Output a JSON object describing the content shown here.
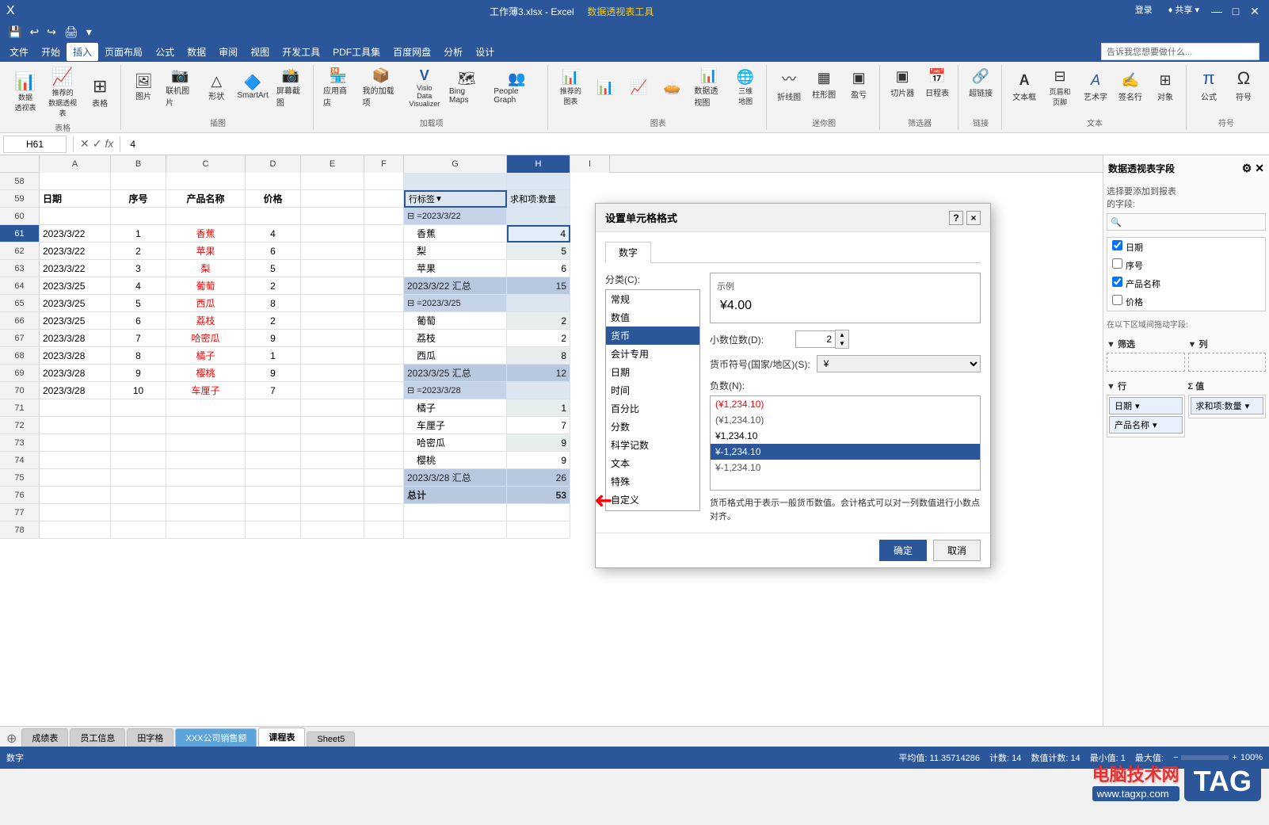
{
  "titleBar": {
    "filename": "工作薄3.xlsx - Excel",
    "toolsTitle": "数据透视表工具",
    "minimizeBtn": "—",
    "maximizeBtn": "□",
    "closeBtn": "✕"
  },
  "menuBar": {
    "items": [
      "文件",
      "开始",
      "插入",
      "页面布局",
      "公式",
      "数据",
      "审阅",
      "视图",
      "开发工具",
      "PDF工具集",
      "百度网盘",
      "分析",
      "设计"
    ]
  },
  "ribbon": {
    "activeTab": "插入",
    "groups": [
      {
        "label": "表格",
        "items": [
          {
            "id": "pivot-data",
            "icon": "📊",
            "label": "数据\n透视表"
          },
          {
            "id": "recommend",
            "icon": "📈",
            "label": "推荐的\n数据透视表"
          },
          {
            "id": "table",
            "icon": "⊞",
            "label": "表格"
          }
        ]
      },
      {
        "label": "插图",
        "items": [
          {
            "id": "image",
            "icon": "🖼",
            "label": "图片"
          },
          {
            "id": "phone-image",
            "icon": "📷",
            "label": "联机图片"
          },
          {
            "id": "shape",
            "icon": "△",
            "label": "形状"
          },
          {
            "id": "smartart",
            "icon": "🔷",
            "label": "SmartArt"
          },
          {
            "id": "screenshot",
            "icon": "📸",
            "label": "屏幕截图"
          }
        ]
      },
      {
        "label": "加载项",
        "items": [
          {
            "id": "app-store",
            "icon": "🏪",
            "label": "应用商店"
          },
          {
            "id": "my-addins",
            "icon": "📦",
            "label": "我的加载项"
          },
          {
            "id": "visio",
            "icon": "V",
            "label": "Visio Data\nVisualizer"
          },
          {
            "id": "bing-maps",
            "icon": "🗺",
            "label": "Bing Maps"
          },
          {
            "id": "people-graph",
            "icon": "👥",
            "label": "People Graph"
          }
        ]
      },
      {
        "label": "图表",
        "items": [
          {
            "id": "recommend-chart",
            "icon": "📊",
            "label": "推荐的\n图表"
          },
          {
            "id": "bar-chart",
            "icon": "📊",
            "label": ""
          },
          {
            "id": "line-chart",
            "icon": "📈",
            "label": ""
          },
          {
            "id": "pie-chart",
            "icon": "🥧",
            "label": ""
          },
          {
            "id": "pivot-chart",
            "icon": "📊",
            "label": "数据透视图"
          },
          {
            "id": "3d-map",
            "icon": "🌐",
            "label": "三维\n地图"
          }
        ]
      },
      {
        "label": "迷你图",
        "items": [
          {
            "id": "sparkline-line",
            "icon": "〰",
            "label": "折线图"
          },
          {
            "id": "sparkline-bar",
            "icon": "▦",
            "label": "柱形图"
          },
          {
            "id": "sparkline-win-loss",
            "icon": "▣",
            "label": "盈亏"
          }
        ]
      },
      {
        "label": "筛选器",
        "items": [
          {
            "id": "slicer",
            "icon": "▣",
            "label": "切片器"
          },
          {
            "id": "timeline",
            "icon": "📅",
            "label": "日程表"
          }
        ]
      },
      {
        "label": "链接",
        "items": [
          {
            "id": "hyperlink",
            "icon": "🔗",
            "label": "超链接"
          }
        ]
      },
      {
        "label": "文本",
        "items": [
          {
            "id": "textbox",
            "icon": "A",
            "label": "文本框"
          },
          {
            "id": "header-footer",
            "icon": "⊟",
            "label": "页眉和页脚"
          },
          {
            "id": "wordart",
            "icon": "A",
            "label": "艺术字"
          },
          {
            "id": "signature",
            "icon": "✍",
            "label": "签名行"
          },
          {
            "id": "object",
            "icon": "⊞",
            "label": "对象"
          }
        ]
      },
      {
        "label": "符号",
        "items": [
          {
            "id": "formula",
            "icon": "π",
            "label": "公式"
          },
          {
            "id": "symbol",
            "icon": "Ω",
            "label": "符号"
          }
        ]
      }
    ],
    "searchPlaceholder": "告诉我您想要做什么..."
  },
  "quickAccess": {
    "buttons": [
      "💾",
      "↩",
      "↪",
      "📋",
      "🖨"
    ]
  },
  "formulaBar": {
    "nameBox": "H61",
    "formula": "4",
    "icons": [
      "✕",
      "✓",
      "fx"
    ]
  },
  "columns": {
    "headers": [
      "",
      "A",
      "B",
      "C",
      "D",
      "E",
      "F",
      "G",
      "H",
      "I"
    ],
    "widths": [
      50,
      90,
      70,
      100,
      70,
      80,
      50,
      120,
      80,
      50
    ]
  },
  "rows": [
    {
      "num": 58,
      "cells": [
        "",
        "",
        "",
        "",
        "",
        "",
        "",
        "",
        "",
        ""
      ]
    },
    {
      "num": 59,
      "cells": [
        "",
        "日期",
        "序号",
        "产品名称",
        "价格",
        "",
        "",
        "行标签",
        "求和项:数量",
        ""
      ]
    },
    {
      "num": 60,
      "cells": [
        "",
        "",
        "",
        "",
        "",
        "",
        "",
        "=2023/3/22",
        "",
        ""
      ]
    },
    {
      "num": 61,
      "cells": [
        "",
        "2023/3/22",
        "1",
        "香蕉",
        "4",
        "",
        "",
        "香蕉",
        "4",
        ""
      ]
    },
    {
      "num": 62,
      "cells": [
        "",
        "2023/3/22",
        "2",
        "苹果",
        "6",
        "",
        "",
        "梨",
        "5",
        ""
      ]
    },
    {
      "num": 63,
      "cells": [
        "",
        "2023/3/22",
        "3",
        "梨",
        "5",
        "",
        "",
        "苹果",
        "6",
        ""
      ]
    },
    {
      "num": 64,
      "cells": [
        "",
        "2023/3/25",
        "4",
        "葡萄",
        "2",
        "",
        "",
        "2023/3/22 汇总",
        "15",
        ""
      ]
    },
    {
      "num": 65,
      "cells": [
        "",
        "2023/3/25",
        "5",
        "西瓜",
        "8",
        "",
        "",
        "=2023/3/25",
        "",
        ""
      ]
    },
    {
      "num": 66,
      "cells": [
        "",
        "2023/3/25",
        "6",
        "荔枝",
        "2",
        "",
        "",
        "葡萄",
        "2",
        ""
      ]
    },
    {
      "num": 67,
      "cells": [
        "",
        "2023/3/28",
        "7",
        "哈密瓜",
        "9",
        "",
        "",
        "荔枝",
        "2",
        ""
      ]
    },
    {
      "num": 68,
      "cells": [
        "",
        "2023/3/28",
        "8",
        "橘子",
        "1",
        "",
        "",
        "西瓜",
        "8",
        ""
      ]
    },
    {
      "num": 69,
      "cells": [
        "",
        "2023/3/28",
        "9",
        "樱桃",
        "9",
        "",
        "",
        "2023/3/25 汇总",
        "12",
        ""
      ]
    },
    {
      "num": 70,
      "cells": [
        "",
        "2023/3/28",
        "10",
        "车厘子",
        "7",
        "",
        "",
        "=2023/3/28",
        "",
        ""
      ]
    },
    {
      "num": 71,
      "cells": [
        "",
        "",
        "",
        "",
        "",
        "",
        "",
        "橘子",
        "1",
        ""
      ]
    },
    {
      "num": 72,
      "cells": [
        "",
        "",
        "",
        "",
        "",
        "",
        "",
        "车厘子",
        "7",
        ""
      ]
    },
    {
      "num": 73,
      "cells": [
        "",
        "",
        "",
        "",
        "",
        "",
        "",
        "哈密瓜",
        "9",
        ""
      ]
    },
    {
      "num": 74,
      "cells": [
        "",
        "",
        "",
        "",
        "",
        "",
        "",
        "樱桃",
        "9",
        ""
      ]
    },
    {
      "num": 75,
      "cells": [
        "",
        "",
        "",
        "",
        "",
        "",
        "",
        "2023/3/28 汇总",
        "26",
        ""
      ]
    },
    {
      "num": 76,
      "cells": [
        "",
        "",
        "",
        "",
        "",
        "",
        "",
        "总计",
        "53",
        ""
      ]
    },
    {
      "num": 77,
      "cells": [
        "",
        "",
        "",
        "",
        "",
        "",
        "",
        "",
        "",
        ""
      ]
    },
    {
      "num": 78,
      "cells": [
        "",
        "",
        "",
        "",
        "",
        "",
        "",
        "",
        "",
        ""
      ]
    }
  ],
  "sheetTabs": [
    {
      "label": "成绩表",
      "active": false,
      "color": "normal"
    },
    {
      "label": "员工信息",
      "active": false,
      "color": "normal"
    },
    {
      "label": "田字格",
      "active": false,
      "color": "normal"
    },
    {
      "label": "XXX公司销售额",
      "active": false,
      "color": "blue"
    },
    {
      "label": "课程表",
      "active": true,
      "color": "normal"
    },
    {
      "label": "Sheet5",
      "active": false,
      "color": "normal"
    }
  ],
  "statusBar": {
    "mode": "数字",
    "average": "平均值: 11.35714286",
    "count": "计数: 14",
    "numCount": "数值计数: 14",
    "min": "最小值: 1",
    "max": "最大值:",
    "zoom": "100%"
  },
  "dialog": {
    "title": "设置单元格格式",
    "helpBtn": "?",
    "closeBtn": "×",
    "tabs": [
      "数字"
    ],
    "categoryLabel": "分类(C):",
    "categories": [
      "常规",
      "数值",
      "货币",
      "会计专用",
      "日期",
      "时间",
      "百分比",
      "分数",
      "科学记数",
      "文本",
      "特殊",
      "自定义"
    ],
    "selectedCategory": "货币",
    "sampleLabel": "示例",
    "sampleValue": "¥4.00",
    "decimalLabel": "小数位数(D):",
    "decimalValue": "2",
    "currencyLabel": "货币符号(国家/地区)(S):",
    "currencyValue": "¥",
    "negativeLabel": "负数(N):",
    "negativeValues": [
      "(¥1,234.10)",
      "(¥1,234.10)",
      "¥1,234.10",
      "¥-1,234.10",
      "¥-1,234.10"
    ],
    "selectedNegative": "¥-1,234.10",
    "description": "货币格式用于表示一般货币数值。会计格式可以对一列数值进行小数点对齐。",
    "okLabel": "确定",
    "cancelLabel": "取消"
  },
  "rightPanel": {
    "title": "数据透视表字段",
    "closeBtn": "×",
    "fieldsLabel": "选择要添加到报表\n的字段:",
    "searchIcon": "🔍",
    "gearIcon": "⚙",
    "fields": [
      "日期",
      "序号",
      "产品名称",
      "价格"
    ],
    "sections": {
      "filterLabel": "筛选",
      "columnLabel": "列",
      "rowLabel": "行",
      "valueLabel": "值"
    },
    "rowItems": [
      "日期",
      "产品名称"
    ],
    "valueItems": [
      "求和项:数量"
    ]
  },
  "watermark": {
    "topText": "电脑技术网",
    "bottomText": "www.tagxp.com",
    "tagText": "TAG"
  }
}
